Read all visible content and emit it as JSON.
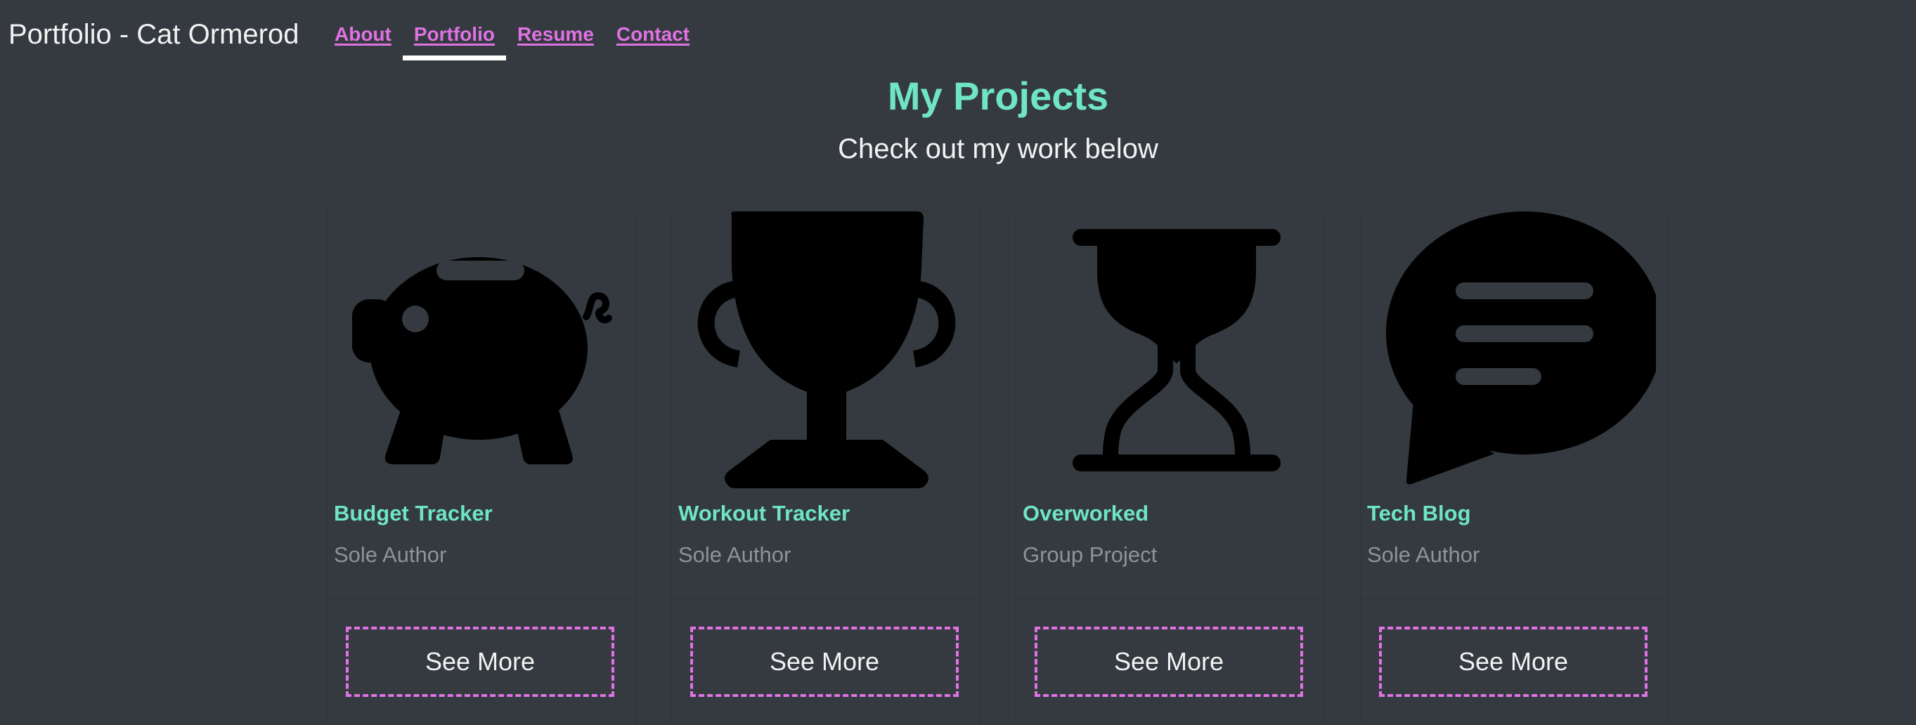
{
  "header": {
    "title": "Portfolio - Cat Ormerod",
    "nav": [
      {
        "label": "About"
      },
      {
        "label": "Portfolio",
        "active": true
      },
      {
        "label": "Resume"
      },
      {
        "label": "Contact"
      }
    ]
  },
  "hero": {
    "title": "My Projects",
    "subtitle": "Check out my work below"
  },
  "projects": [
    {
      "title": "Budget Tracker",
      "role": "Sole Author",
      "button": "See More",
      "icon": "piggy-bank-icon"
    },
    {
      "title": "Workout Tracker",
      "role": "Sole Author",
      "button": "See More",
      "icon": "trophy-icon"
    },
    {
      "title": "Overworked",
      "role": "Group Project",
      "button": "See More",
      "icon": "hourglass-icon"
    },
    {
      "title": "Tech Blog",
      "role": "Sole Author",
      "button": "See More",
      "icon": "speech-bubble-icon"
    }
  ],
  "colors": {
    "background": "#343a3f",
    "accent_green": "#6fe5c2",
    "accent_pink": "#e072e4",
    "text_light": "#f2f2f2",
    "text_muted": "#8e9398"
  }
}
